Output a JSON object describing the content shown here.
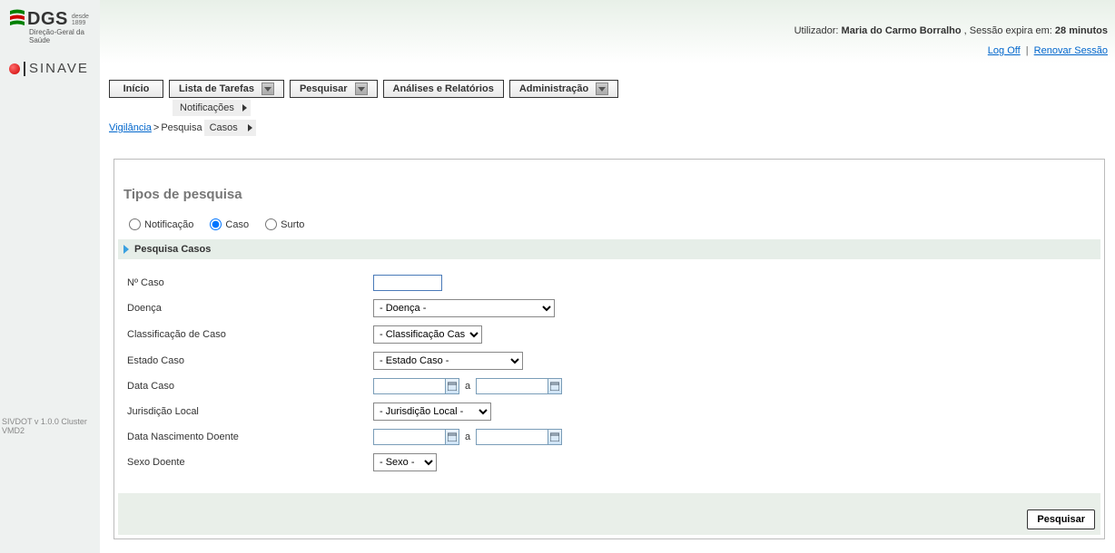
{
  "brand": {
    "dgs": "DGS",
    "since_label": "desde",
    "since_year": "1899",
    "subtitle": "Direção-Geral da Saúde",
    "sinave": "SINAVE"
  },
  "userbar": {
    "prefix": "Utilizador:",
    "username": "Maria do Carmo Borralho",
    "session_prefix": ", Sessão expira em:",
    "session_time": "28 minutos",
    "logoff": "Log Off",
    "renew": "Renovar Sessão"
  },
  "menu": {
    "inicio": "Início",
    "lista": "Lista de Tarefas",
    "pesquisar": "Pesquisar",
    "analises": "Análises e Relatórios",
    "admin": "Administração"
  },
  "submenu": {
    "notificacoes": "Notificações",
    "casos": "Casos"
  },
  "breadcrumb": {
    "vigilancia": "Vigilância",
    "pesquisa": "Pesquisa",
    "casos": "Casos"
  },
  "panel": {
    "title": "Tipos de pesquisa",
    "radios": {
      "notificacao": "Notificação",
      "caso": "Caso",
      "surto": "Surto"
    },
    "section": "Pesquisa Casos",
    "labels": {
      "ncaso": "Nº Caso",
      "doenca": "Doença",
      "classificacao": "Classificação de Caso",
      "estado": "Estado Caso",
      "data_caso": "Data Caso",
      "jurisdicao": "Jurisdição Local",
      "nascimento": "Data Nascimento Doente",
      "sexo": "Sexo Doente",
      "a": "a"
    },
    "selects": {
      "doenca": "- Doença -",
      "classificacao": "- Classificação Caso -",
      "estado": "- Estado Caso -",
      "jurisdicao": "- Jurisdição Local -",
      "sexo": "- Sexo -"
    },
    "search_btn": "Pesquisar"
  },
  "footer": {
    "version": "SIVDOT v 1.0.0 Cluster VMD2"
  }
}
